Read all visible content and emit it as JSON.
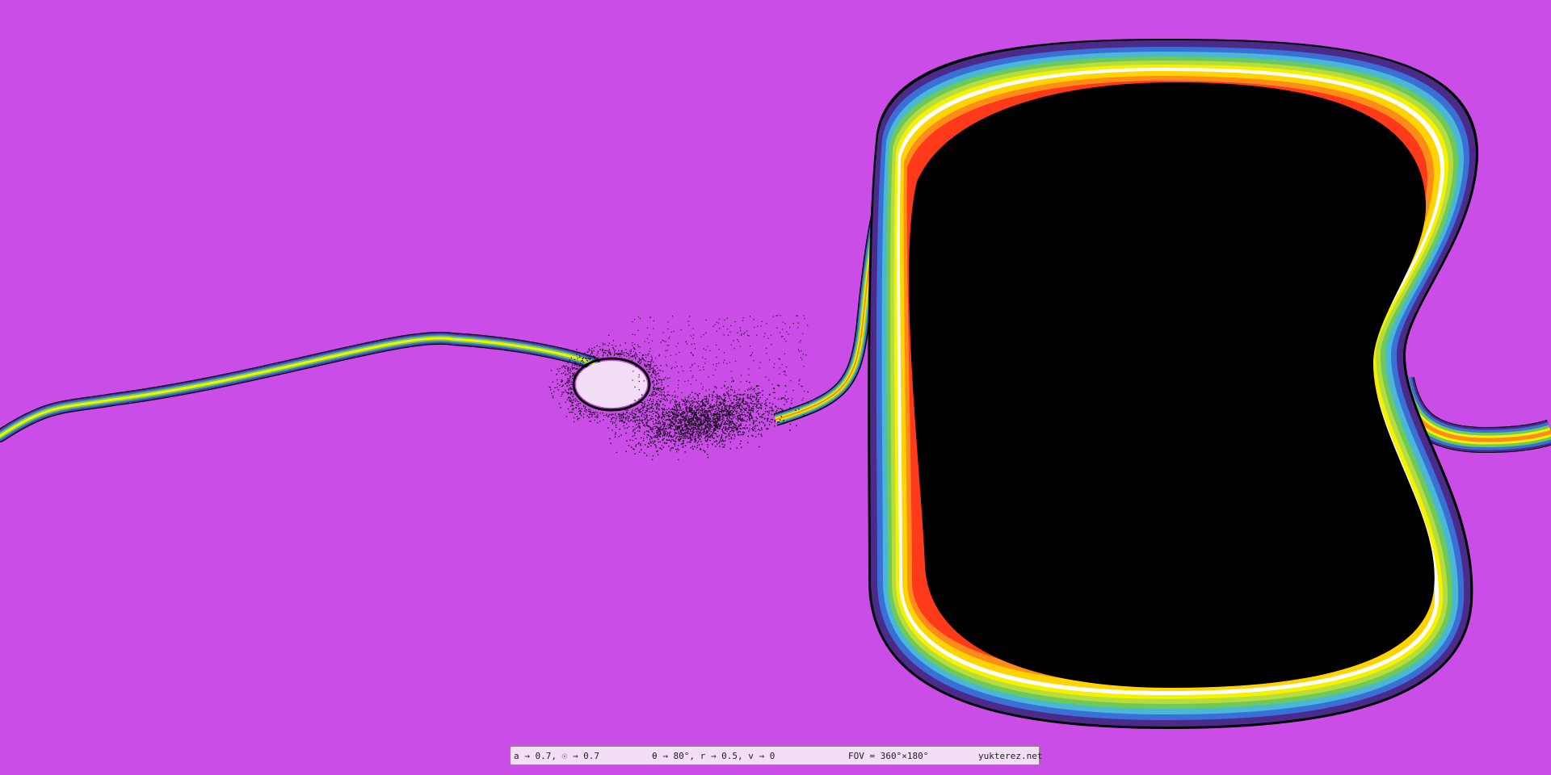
{
  "scene": {
    "background_color": "#c94de6",
    "shadow_color": "#000000",
    "ring_colors": [
      "#000000",
      "#4b2a8a",
      "#3a6fd8",
      "#49b7d6",
      "#6cc95a",
      "#b7dd3c",
      "#f4f200",
      "#ffffff",
      "#ffd400",
      "#ff8c1a",
      "#ff3a1a"
    ]
  },
  "status": {
    "spin_params": "a → 0.7, ☉ → 0.7",
    "view_params": "θ → 80°, r → 0.5, v → 0",
    "fov": "FOV = 360°×180°",
    "site": "yukterez.net"
  }
}
